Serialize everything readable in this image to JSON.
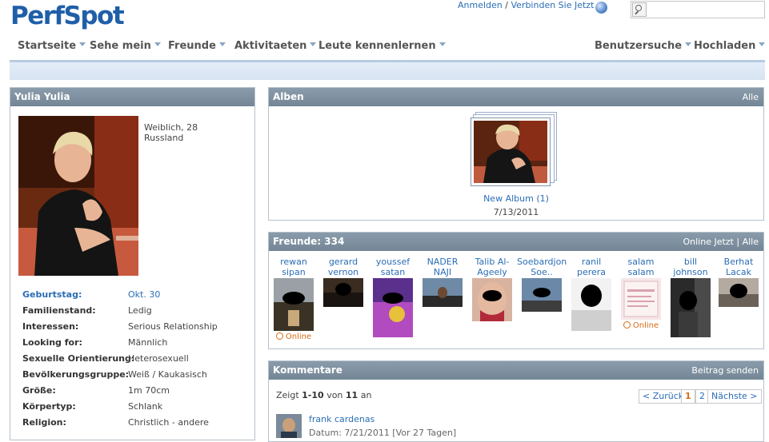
{
  "header": {
    "logo": "PerfSpot",
    "signin": "Anmelden",
    "separator": "/",
    "connect": "Verbinden Sie Jetzt"
  },
  "nav": {
    "items": [
      "Startseite",
      "Sehe mein",
      "Freunde",
      "Aktivitaeten",
      "Leute kennenlernen"
    ],
    "right_items": [
      "Benutzersuche",
      "Hochladen"
    ]
  },
  "profile": {
    "title": "Yulia Yulia",
    "gender_age": "Weiblich, 28",
    "country": "Russland",
    "info": [
      {
        "label": "Geburtstag:",
        "value": "Okt. 30",
        "label_link": true,
        "value_link": true
      },
      {
        "label": "Familienstand:",
        "value": "Ledig"
      },
      {
        "label": "Interessen:",
        "value": "Serious Relationship"
      },
      {
        "label": "Looking for:",
        "value": "Männlich"
      },
      {
        "label": "Sexuelle Orientierung:",
        "value": "Heterosexuell"
      },
      {
        "label": "Bevölkerungsgruppe:",
        "value": "Weiß / Kaukasisch"
      },
      {
        "label": "Größe:",
        "value": "1m 70cm"
      },
      {
        "label": "Körpertyp:",
        "value": "Schlank"
      },
      {
        "label": "Religion:",
        "value": "Christlich - andere"
      }
    ]
  },
  "albums": {
    "title": "Alben",
    "all_link": "Alle",
    "album_name": "New Album (1)",
    "album_date": "7/13/2011"
  },
  "friends": {
    "title": "Freunde: 334",
    "online_link": "Online Jetzt",
    "separator": "|",
    "all_link": "Alle",
    "online_label": "Online",
    "list": [
      {
        "name": "rewan sipan",
        "online": true
      },
      {
        "name": "gerard vernon",
        "online": false
      },
      {
        "name": "youssef satan",
        "online": false
      },
      {
        "name": "NADER NAJI",
        "online": false
      },
      {
        "name": "Talib Al-Ageely",
        "online": false
      },
      {
        "name": "Soebardjono Soe..",
        "online": false
      },
      {
        "name": "ranil perera",
        "online": false
      },
      {
        "name": "salam salam",
        "online": true
      },
      {
        "name": "bill johnson",
        "online": false
      },
      {
        "name": "Berhat Lacak",
        "online": false
      }
    ]
  },
  "comments": {
    "title": "Kommentare",
    "post_link": "Beitrag senden",
    "showing_prefix": "Zeigt",
    "showing_range": "1-10",
    "showing_of": "von",
    "showing_total": "11",
    "showing_suffix": "an",
    "prev": "< Zurück",
    "page1": "1",
    "page2": "2",
    "next": "Nächste >",
    "first_author": "frank cardenas",
    "first_date": "Datum: 7/21/2011 [Vor 27 Tagen]"
  }
}
